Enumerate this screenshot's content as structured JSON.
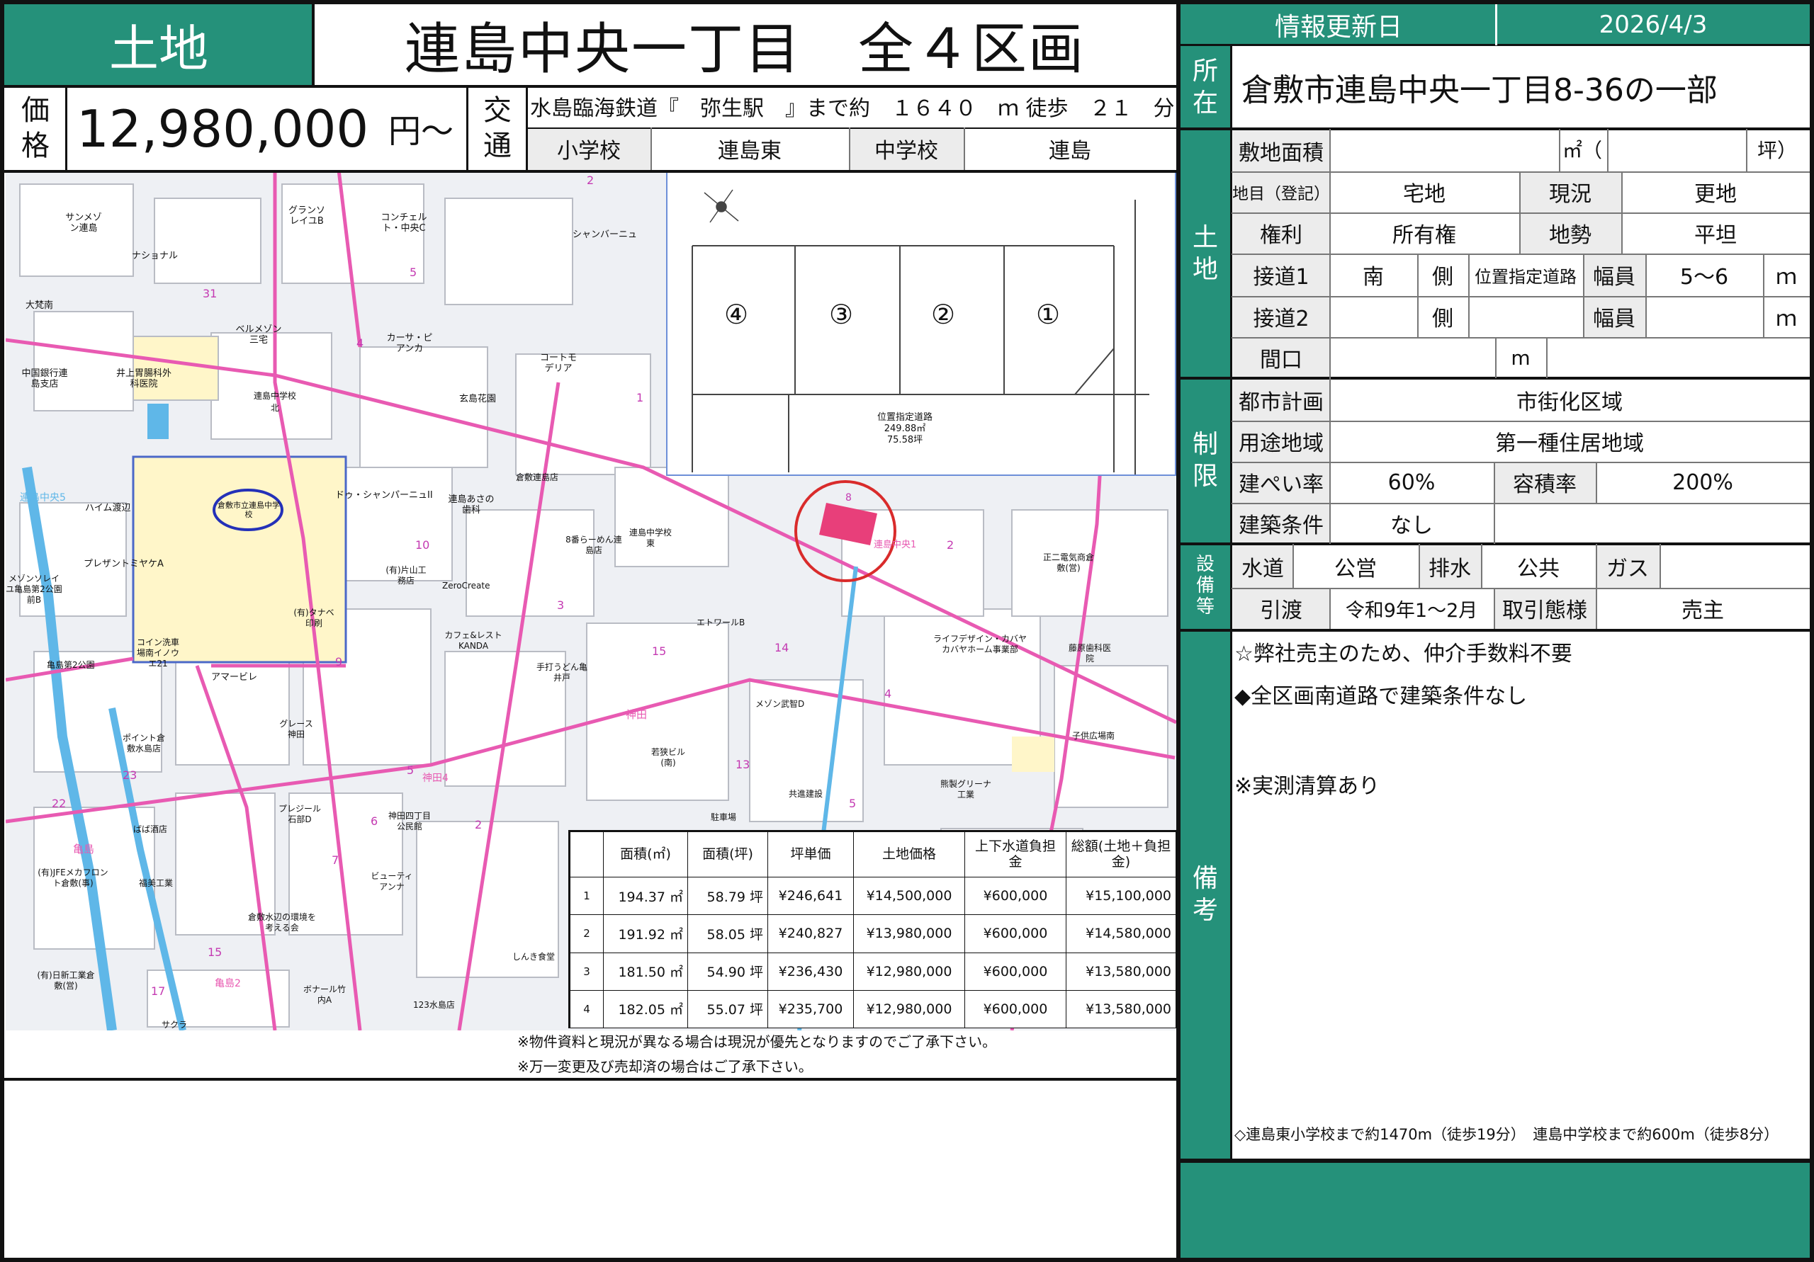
{
  "header": {
    "category": "土地",
    "title": "連島中央一丁目　全４区画",
    "info_update_label": "情報更新日",
    "info_update_date": "2026/4/3"
  },
  "price": {
    "label_top": "価",
    "label_bottom": "格",
    "value": "12,980,000",
    "unit": "円～"
  },
  "transport": {
    "label_top": "交",
    "label_bottom": "通",
    "line": "水島臨海鉄道『　弥生駅　』まで約　１６４０　ｍ 徒歩　２１　分",
    "elementary_label": "小学校",
    "elementary_value": "連島東",
    "junior_label": "中学校",
    "junior_value": "連島"
  },
  "location": {
    "label_top": "所",
    "label_bottom": "在",
    "value": "倉敷市連島中央一丁目8-36の一部"
  },
  "land": {
    "section_label_top": "土",
    "section_label_bottom": "地",
    "area_label": "敷地面積",
    "area_unit_m": "㎡（",
    "area_unit_tsubo": "坪）",
    "chimoku_label": "地目（登記）",
    "chimoku_value": "宅地",
    "genkyo_label": "現況",
    "genkyo_value": "更地",
    "kenri_label": "権利",
    "kenri_value": "所有権",
    "chisei_label": "地勢",
    "chisei_value": "平坦",
    "road1_label": "接道1",
    "road1_dir": "南",
    "road1_side": "側",
    "road1_type": "位置指定道路",
    "road1_width_label": "幅員",
    "road1_width": "5～6",
    "road1_unit": "ｍ",
    "road2_label": "接道2",
    "road2_side": "側",
    "road2_width_label": "幅員",
    "road2_unit": "ｍ",
    "maguchi_label": "間口",
    "maguchi_unit": "m"
  },
  "restrict": {
    "section_label_top": "制",
    "section_label_bottom": "限",
    "city_label": "都市計画",
    "city_value": "市街化区域",
    "use_label": "用途地域",
    "use_value": "第一種住居地域",
    "bcr_label": "建ぺい率",
    "bcr_value": "60%",
    "far_label": "容積率",
    "far_value": "200%",
    "cond_label": "建築条件",
    "cond_value": "なし"
  },
  "facility": {
    "section_label": [
      "設",
      "備",
      "等"
    ],
    "water_label": "水道",
    "water_value": "公営",
    "drain_label": "排水",
    "drain_value": "公共",
    "gas_label": "ガス",
    "delivery_label": "引渡",
    "delivery_value": "令和9年1～2月",
    "deal_label": "取引態様",
    "deal_value": "売主"
  },
  "remarks": {
    "section_label_top": "備",
    "section_label_bottom": "考",
    "line1": "☆弊社売主のため、仲介手数料不要",
    "line2": "◆全区画南道路で建築条件なし",
    "line3": "※実測清算あり",
    "footer": "◇連島東小学校まで約1470m（徒歩19分）　連島中学校まで約600m（徒歩8分）"
  },
  "plot": {
    "lots": [
      "④",
      "③",
      "②",
      "①"
    ],
    "road_label": "位置指定道路",
    "road_area_m": "249.88㎡",
    "road_area_tsubo": "75.58坪"
  },
  "map_labels": [
    "サンメゾン連島",
    "ナショナル",
    "グランソレイユB",
    "コンチェルト・中央C",
    "シャンバーニュ",
    "大梵南",
    "中国銀行連島支店",
    "井上胃腸科外科医院",
    "ベルメゾン三宅",
    "カーサ・ピアンカ",
    "コートモデリア",
    "玄島花園",
    "連島中学校北",
    "倉敷市立連島中学校",
    "ドゥ・シャンパーニュII",
    "連島あさの歯科",
    "8番らーめん連島店",
    "連島中学校東",
    "連島中央1",
    "正二電気商倉敷(営)",
    "ハイム渡辺",
    "プレザントミヤケA",
    "メゾンソレイユ亀島第2公園前B",
    "コイン洗車場南イノウエ21",
    "亀島第2公園",
    "ポイント倉敷水島店",
    "アマービレ",
    "グレース神田",
    "(有)片山工務店",
    "ZeroCreate",
    "カフェ&レストKANDA",
    "手打うどん亀井戸",
    "エトワールB",
    "メゾン武智D",
    "若狭ビル(南)",
    "共進建設",
    "駐車場",
    "ライフデザイン・カバヤカバヤホーム事業部",
    "藤原歯科医院",
    "子供広場南",
    "(有)タナベ印刷",
    "プレジール石部D",
    "神田四丁目公民館",
    "ビューティアンナ",
    "倉敷水辺の環境を考える会",
    "ばば酒店",
    "(有)JFEメカフロント倉敷(事)",
    "福美工業",
    "亀島",
    "神田",
    "神田4",
    "亀島2",
    "連島中央5",
    "(有)日新工業倉敷(営)",
    "ボナール竹内A",
    "123水島店",
    "しんき食堂",
    "サクラ",
    "熊製グリーナ工業",
    "倉敷連島店"
  ],
  "map_numbers": [
    "31",
    "5",
    "4",
    "1",
    "2",
    "10",
    "3",
    "15",
    "14",
    "4",
    "13",
    "5",
    "9",
    "6",
    "7",
    "2",
    "5",
    "22",
    "23",
    "15",
    "17",
    "8",
    "2"
  ],
  "price_table": {
    "headers": [
      "",
      "面積(㎡)",
      "面積(坪)",
      "坪単価",
      "土地価格",
      "上下水道負担金",
      "総額(土地＋負担金)"
    ],
    "rows": [
      [
        "1",
        "194.37",
        "58.79",
        "¥246,641",
        "¥14,500,000",
        "¥600,000",
        "¥15,100,000"
      ],
      [
        "2",
        "191.92",
        "58.05",
        "¥240,827",
        "¥13,980,000",
        "¥600,000",
        "¥14,580,000"
      ],
      [
        "3",
        "181.50",
        "54.90",
        "¥236,430",
        "¥12,980,000",
        "¥600,000",
        "¥13,580,000"
      ],
      [
        "4",
        "182.05",
        "55.07",
        "¥235,700",
        "¥12,980,000",
        "¥600,000",
        "¥13,580,000"
      ]
    ],
    "unit_m": "㎡",
    "unit_tsubo": "坪"
  },
  "notes": {
    "note1": "※物件資料と現況が異なる場合は現況が優先となりますのでご了承下さい。",
    "note2": "※万一変更及び売却済の場合はご了承下さい。"
  },
  "colors": {
    "accent": "#25917a",
    "lot_highlight": "#e83f7a",
    "map_road": "#e85ab2",
    "map_river": "#5fb7e8"
  }
}
